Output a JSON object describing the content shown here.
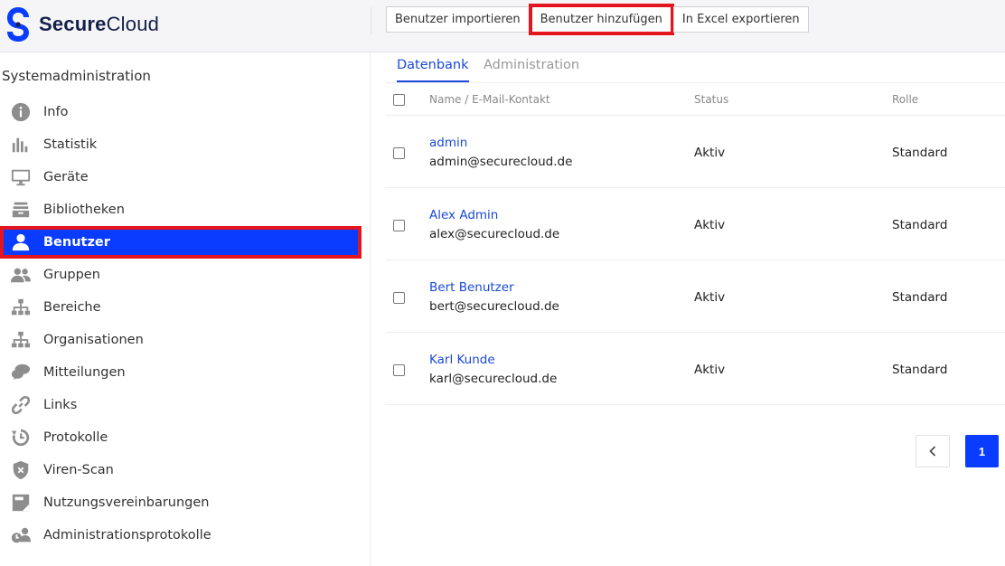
{
  "app": {
    "brand_bold": "Secure",
    "brand_light": "Cloud"
  },
  "toolbar": {
    "import_label": "Benutzer importieren",
    "add_label": "Benutzer hinzufügen",
    "export_label": "In Excel exportieren"
  },
  "sidebar": {
    "heading": "Systemadministration",
    "items": [
      {
        "label": "Info",
        "icon": "info-icon"
      },
      {
        "label": "Statistik",
        "icon": "bar-chart-icon"
      },
      {
        "label": "Geräte",
        "icon": "monitor-icon"
      },
      {
        "label": "Bibliotheken",
        "icon": "library-icon"
      },
      {
        "label": "Benutzer",
        "icon": "user-icon"
      },
      {
        "label": "Gruppen",
        "icon": "group-icon"
      },
      {
        "label": "Bereiche",
        "icon": "hierarchy-icon"
      },
      {
        "label": "Organisationen",
        "icon": "organization-icon"
      },
      {
        "label": "Mitteilungen",
        "icon": "chat-icon"
      },
      {
        "label": "Links",
        "icon": "link-icon"
      },
      {
        "label": "Protokolle",
        "icon": "history-icon"
      },
      {
        "label": "Viren-Scan",
        "icon": "shield-icon"
      },
      {
        "label": "Nutzungsvereinbarungen",
        "icon": "document-icon"
      },
      {
        "label": "Administrationsprotokolle",
        "icon": "admin-log-icon"
      }
    ],
    "active_item": "Benutzer"
  },
  "tabs": {
    "active": "Datenbank",
    "inactive": "Administration"
  },
  "table": {
    "columns": {
      "name": "Name / E-Mail-Kontakt",
      "status": "Status",
      "role": "Rolle"
    },
    "rows": [
      {
        "name": "admin",
        "email": "admin@securecloud.de",
        "status": "Aktiv",
        "role": "Standard"
      },
      {
        "name": "Alex Admin",
        "email": "alex@securecloud.de",
        "status": "Aktiv",
        "role": "Standard"
      },
      {
        "name": "Bert Benutzer",
        "email": "bert@securecloud.de",
        "status": "Aktiv",
        "role": "Standard"
      },
      {
        "name": "Karl Kunde",
        "email": "karl@securecloud.de",
        "status": "Aktiv",
        "role": "Standard"
      }
    ]
  },
  "pagination": {
    "current_page": "1"
  },
  "colors": {
    "accent": "#0a3cff",
    "highlight": "#e3151f",
    "link": "#1a49d6",
    "brand": "#15204a"
  }
}
